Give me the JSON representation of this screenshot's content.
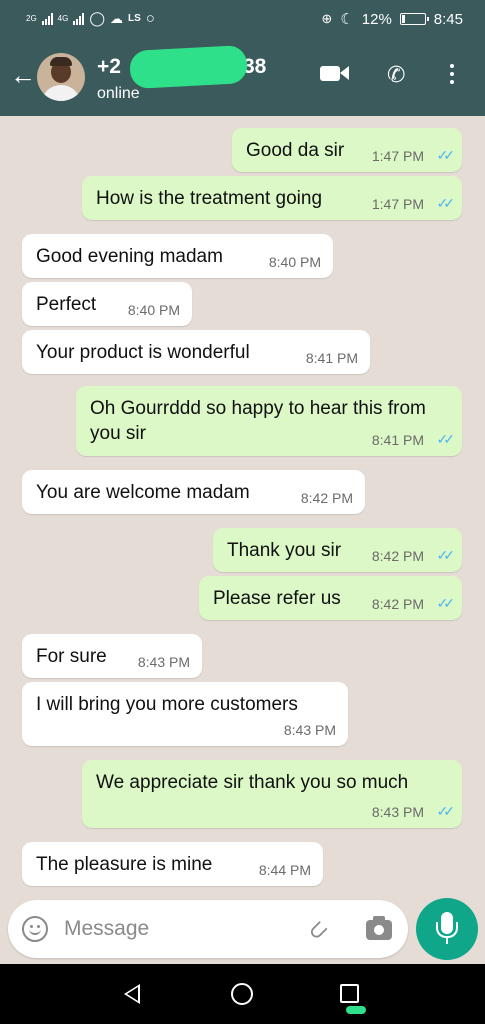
{
  "status_bar": {
    "network_left": "2G",
    "network_right": "4G",
    "carrier_tag": "LS",
    "battery_percent": "12%",
    "battery_level": 0.12,
    "time": "8:45"
  },
  "header": {
    "contact_visible_prefix": "+2",
    "contact_visible_suffix": "38",
    "status": "online",
    "accent_color": "#3a5a5c"
  },
  "messages": [
    {
      "dir": "out",
      "text": "Good da sir",
      "time": "1:47 PM",
      "ticks": "✓✓"
    },
    {
      "dir": "out",
      "text": "How is the treatment going",
      "time": "1:47 PM",
      "ticks": "✓✓"
    },
    {
      "dir": "in",
      "text": "Good evening madam",
      "time": "8:40 PM"
    },
    {
      "dir": "in",
      "text": "Perfect",
      "time": "8:40 PM"
    },
    {
      "dir": "in",
      "text": "Your product is wonderful",
      "time": "8:41 PM"
    },
    {
      "dir": "out",
      "text": "Oh Gourrddd so happy to hear this from you sir",
      "time": "8:41 PM",
      "ticks": "✓✓"
    },
    {
      "dir": "in",
      "text": "You are welcome madam",
      "time": "8:42 PM"
    },
    {
      "dir": "out",
      "text": "Thank you sir",
      "time": "8:42 PM",
      "ticks": "✓✓"
    },
    {
      "dir": "out",
      "text": "Please refer us",
      "time": "8:42 PM",
      "ticks": "✓✓"
    },
    {
      "dir": "in",
      "text": "For sure",
      "time": "8:43 PM"
    },
    {
      "dir": "in",
      "text": "I will bring you more customers",
      "time": "8:43 PM"
    },
    {
      "dir": "out",
      "text": "We appreciate sir thank you so much",
      "time": "8:43 PM",
      "ticks": "✓✓"
    },
    {
      "dir": "in",
      "text": "The pleasure is mine",
      "time": "8:44 PM"
    }
  ],
  "composer": {
    "placeholder": "Message"
  },
  "icons": [
    "back-arrow-icon",
    "video-call-icon",
    "phone-icon",
    "more-options-icon",
    "emoji-icon",
    "attach-icon",
    "camera-icon",
    "mic-icon"
  ]
}
